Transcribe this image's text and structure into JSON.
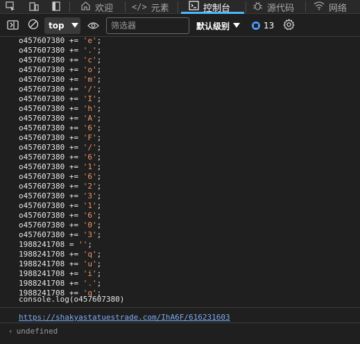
{
  "tabs": [
    {
      "label": "欢迎",
      "icon": "home-icon"
    },
    {
      "label": "元素",
      "icon": "code-icon"
    },
    {
      "label": "控制台",
      "icon": "console-icon",
      "active": true
    },
    {
      "label": "源代码",
      "icon": "bug-icon"
    },
    {
      "label": "网络",
      "icon": "wifi-icon"
    }
  ],
  "toolbar": {
    "context": "top",
    "filter_placeholder": "筛选器",
    "levels_label": "默认级别",
    "issues_count": "13"
  },
  "console": {
    "lines": [
      {
        "var": "o457607380",
        "op": "+=",
        "str": "'e'"
      },
      {
        "var": "o457607380",
        "op": "+=",
        "str": "'.'"
      },
      {
        "var": "o457607380",
        "op": "+=",
        "str": "'c'"
      },
      {
        "var": "o457607380",
        "op": "+=",
        "str": "'o'"
      },
      {
        "var": "o457607380",
        "op": "+=",
        "str": "'m'"
      },
      {
        "var": "o457607380",
        "op": "+=",
        "str": "'/'"
      },
      {
        "var": "o457607380",
        "op": "+=",
        "str": "'I'"
      },
      {
        "var": "o457607380",
        "op": "+=",
        "str": "'h'"
      },
      {
        "var": "o457607380",
        "op": "+=",
        "str": "'A'"
      },
      {
        "var": "o457607380",
        "op": "+=",
        "str": "'6'"
      },
      {
        "var": "o457607380",
        "op": "+=",
        "str": "'F'"
      },
      {
        "var": "o457607380",
        "op": "+=",
        "str": "'/'"
      },
      {
        "var": "o457607380",
        "op": "+=",
        "str": "'6'"
      },
      {
        "var": "o457607380",
        "op": "+=",
        "str": "'1'"
      },
      {
        "var": "o457607380",
        "op": "+=",
        "str": "'6'"
      },
      {
        "var": "o457607380",
        "op": "+=",
        "str": "'2'"
      },
      {
        "var": "o457607380",
        "op": "+=",
        "str": "'3'"
      },
      {
        "var": "o457607380",
        "op": "+=",
        "str": "'1'"
      },
      {
        "var": "o457607380",
        "op": "+=",
        "str": "'6'"
      },
      {
        "var": "o457607380",
        "op": "+=",
        "str": "'0'"
      },
      {
        "var": "o457607380",
        "op": "+=",
        "str": "'3'"
      },
      {
        "var": "1988241708",
        "op": "=",
        "str": "''"
      },
      {
        "var": "1988241708",
        "op": "+=",
        "str": "'q'"
      },
      {
        "var": "1988241708",
        "op": "+=",
        "str": "'u'"
      },
      {
        "var": "1988241708",
        "op": "+=",
        "str": "'i'"
      },
      {
        "var": "1988241708",
        "op": "+=",
        "str": "'.'"
      },
      {
        "var": "1988241708",
        "op": "+=",
        "str": "'q'"
      }
    ],
    "log_fn": "console.log",
    "log_arg": "o457607380",
    "output_link": "https://shakyastatuestrade.com/IhA6F/616231603",
    "result": "undefined"
  },
  "colors": {
    "accent": "#4cb8ff",
    "string": "#f29766",
    "link": "#7cacf8"
  }
}
